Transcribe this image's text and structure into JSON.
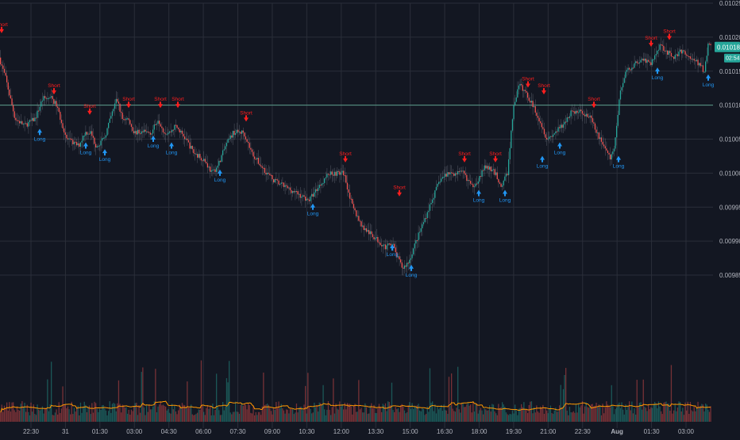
{
  "colors": {
    "background": "#131722",
    "grid": "#2a2e39",
    "up": "#26a69a",
    "down": "#ef5350",
    "wick": "#8a8f9c",
    "axis_text": "#b2b5be",
    "short_signal": "#ff1e1e",
    "long_signal": "#2196f3",
    "volume_ma": "#ff9800",
    "price_badge": "#26a69a",
    "hline": "#5b9c8c"
  },
  "chart_data": {
    "type": "candlestick",
    "title": "",
    "xlabel": "",
    "ylabel": "",
    "ylim": [
      0.009625,
      0.01025
    ],
    "grid": true,
    "y_ticks": [
      "0.010250",
      "0.010200",
      "0.010150",
      "0.010100",
      "0.010050",
      "0.010000",
      "0.009950",
      "0.009900",
      "0.009850"
    ],
    "x_ticks": [
      "22:30",
      "31",
      "01:30",
      "03:00",
      "04:30",
      "06:00",
      "07:30",
      "09:00",
      "10:30",
      "12:00",
      "13:30",
      "15:00",
      "16:30",
      "18:00",
      "19:30",
      "21:00",
      "22:30",
      "Aug",
      "01:30",
      "03:00"
    ],
    "horizontal_line": 0.0101,
    "last_price": "0.010185",
    "countdown": "02:54",
    "price_path": [
      [
        0,
        0.01017
      ],
      [
        8,
        0.01014
      ],
      [
        20,
        0.01008
      ],
      [
        32,
        0.01007
      ],
      [
        45,
        0.01008
      ],
      [
        55,
        0.01011
      ],
      [
        66,
        0.01011
      ],
      [
        72,
        0.0101
      ],
      [
        85,
        0.01005
      ],
      [
        100,
        0.01004
      ],
      [
        108,
        0.01006
      ],
      [
        115,
        0.01006
      ],
      [
        122,
        0.01004
      ],
      [
        132,
        0.01005
      ],
      [
        140,
        0.01008
      ],
      [
        148,
        0.01011
      ],
      [
        155,
        0.01008
      ],
      [
        162,
        0.01008
      ],
      [
        170,
        0.01006
      ],
      [
        180,
        0.01006
      ],
      [
        192,
        0.01006
      ],
      [
        200,
        0.01008
      ],
      [
        208,
        0.01006
      ],
      [
        215,
        0.01006
      ],
      [
        222,
        0.01007
      ],
      [
        235,
        0.01005
      ],
      [
        245,
        0.01003
      ],
      [
        258,
        0.01002
      ],
      [
        268,
        0.01
      ],
      [
        275,
        0.01001
      ],
      [
        285,
        0.01004
      ],
      [
        295,
        0.01006
      ],
      [
        308,
        0.01006
      ],
      [
        318,
        0.01003
      ],
      [
        330,
        0.01001
      ],
      [
        345,
        0.00999
      ],
      [
        360,
        0.00998
      ],
      [
        375,
        0.00997
      ],
      [
        390,
        0.00996
      ],
      [
        402,
        0.00998
      ],
      [
        415,
        0.01
      ],
      [
        425,
        0.01
      ],
      [
        434,
        0.01
      ],
      [
        445,
        0.00995
      ],
      [
        458,
        0.00992
      ],
      [
        468,
        0.00991
      ],
      [
        478,
        0.0099
      ],
      [
        488,
        0.00989
      ],
      [
        494,
        0.0099
      ],
      [
        500,
        0.00988
      ],
      [
        508,
        0.00986
      ],
      [
        516,
        0.00987
      ],
      [
        525,
        0.0099
      ],
      [
        535,
        0.00993
      ],
      [
        545,
        0.00996
      ],
      [
        555,
        0.00999
      ],
      [
        565,
        0.01
      ],
      [
        575,
        0.01
      ],
      [
        585,
        0.01
      ],
      [
        595,
        0.00998
      ],
      [
        603,
        0.00999
      ],
      [
        612,
        0.01001
      ],
      [
        625,
        0.01
      ],
      [
        632,
        0.00998
      ],
      [
        640,
        0.01
      ],
      [
        648,
        0.0101
      ],
      [
        655,
        0.01013
      ],
      [
        662,
        0.01012
      ],
      [
        672,
        0.0101
      ],
      [
        680,
        0.01008
      ],
      [
        690,
        0.01005
      ],
      [
        700,
        0.01006
      ],
      [
        710,
        0.01007
      ],
      [
        720,
        0.01009
      ],
      [
        735,
        0.01009
      ],
      [
        745,
        0.01008
      ],
      [
        752,
        0.01006
      ],
      [
        762,
        0.01004
      ],
      [
        770,
        0.01002
      ],
      [
        775,
        0.01004
      ],
      [
        782,
        0.01012
      ],
      [
        790,
        0.01015
      ],
      [
        800,
        0.01016
      ],
      [
        810,
        0.01017
      ],
      [
        820,
        0.01016
      ],
      [
        825,
        0.01017
      ],
      [
        832,
        0.01019
      ],
      [
        840,
        0.01018
      ],
      [
        848,
        0.01017
      ],
      [
        860,
        0.01018
      ],
      [
        870,
        0.01017
      ],
      [
        882,
        0.01016
      ],
      [
        888,
        0.01015
      ],
      [
        893,
        0.01019
      ],
      [
        896,
        0.01019
      ]
    ],
    "signals": [
      {
        "label": "Short",
        "type": "short",
        "x": 2,
        "price": 0.0102
      },
      {
        "label": "Short",
        "type": "short",
        "x": 68,
        "price": 0.01011
      },
      {
        "label": "Short",
        "type": "short",
        "x": 113,
        "price": 0.01008
      },
      {
        "label": "Short",
        "type": "short",
        "x": 162,
        "price": 0.01009
      },
      {
        "label": "Short",
        "type": "short",
        "x": 202,
        "price": 0.01009
      },
      {
        "label": "Short",
        "type": "short",
        "x": 224,
        "price": 0.01009
      },
      {
        "label": "Short",
        "type": "short",
        "x": 310,
        "price": 0.01007
      },
      {
        "label": "Short",
        "type": "short",
        "x": 435,
        "price": 0.01001
      },
      {
        "label": "Short",
        "type": "short",
        "x": 503,
        "price": 0.00996
      },
      {
        "label": "Short",
        "type": "short",
        "x": 585,
        "price": 0.01001
      },
      {
        "label": "Short",
        "type": "short",
        "x": 624,
        "price": 0.01001
      },
      {
        "label": "Short",
        "type": "short",
        "x": 665,
        "price": 0.01012
      },
      {
        "label": "Short",
        "type": "short",
        "x": 685,
        "price": 0.01011
      },
      {
        "label": "Short",
        "type": "short",
        "x": 748,
        "price": 0.01009
      },
      {
        "label": "Short",
        "type": "short",
        "x": 820,
        "price": 0.01018
      },
      {
        "label": "Short",
        "type": "short",
        "x": 843,
        "price": 0.01019
      },
      {
        "label": "Long",
        "type": "long",
        "x": 50,
        "price": 0.01007
      },
      {
        "label": "Long",
        "type": "long",
        "x": 108,
        "price": 0.01005
      },
      {
        "label": "Long",
        "type": "long",
        "x": 132,
        "price": 0.01004
      },
      {
        "label": "Long",
        "type": "long",
        "x": 193,
        "price": 0.01006
      },
      {
        "label": "Long",
        "type": "long",
        "x": 216,
        "price": 0.01005
      },
      {
        "label": "Long",
        "type": "long",
        "x": 277,
        "price": 0.01001
      },
      {
        "label": "Long",
        "type": "long",
        "x": 394,
        "price": 0.00996
      },
      {
        "label": "Long",
        "type": "long",
        "x": 494,
        "price": 0.0099
      },
      {
        "label": "Long",
        "type": "long",
        "x": 518,
        "price": 0.00987
      },
      {
        "label": "Long",
        "type": "long",
        "x": 603,
        "price": 0.00998
      },
      {
        "label": "Long",
        "type": "long",
        "x": 636,
        "price": 0.00998
      },
      {
        "label": "Long",
        "type": "long",
        "x": 683,
        "price": 0.01003
      },
      {
        "label": "Long",
        "type": "long",
        "x": 705,
        "price": 0.01005
      },
      {
        "label": "Long",
        "type": "long",
        "x": 779,
        "price": 0.01003
      },
      {
        "label": "Long",
        "type": "long",
        "x": 828,
        "price": 0.01016
      },
      {
        "label": "Long",
        "type": "long",
        "x": 892,
        "price": 0.01015
      }
    ]
  }
}
